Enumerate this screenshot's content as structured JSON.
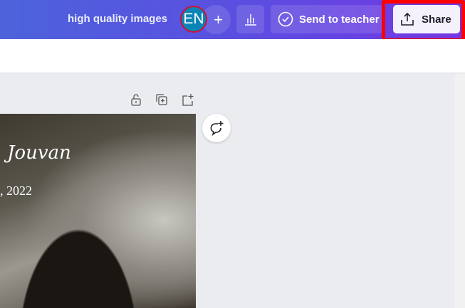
{
  "header": {
    "title": "high quality images",
    "avatar_initials": "EN",
    "add_label": "+",
    "send_label": "Send to teacher",
    "share_label": "Share"
  },
  "canvas": {
    "script_text": "Jouvan",
    "date_text": ", 2022"
  },
  "colors": {
    "highlight": "#ff0000",
    "avatar": "#0a84b6"
  }
}
